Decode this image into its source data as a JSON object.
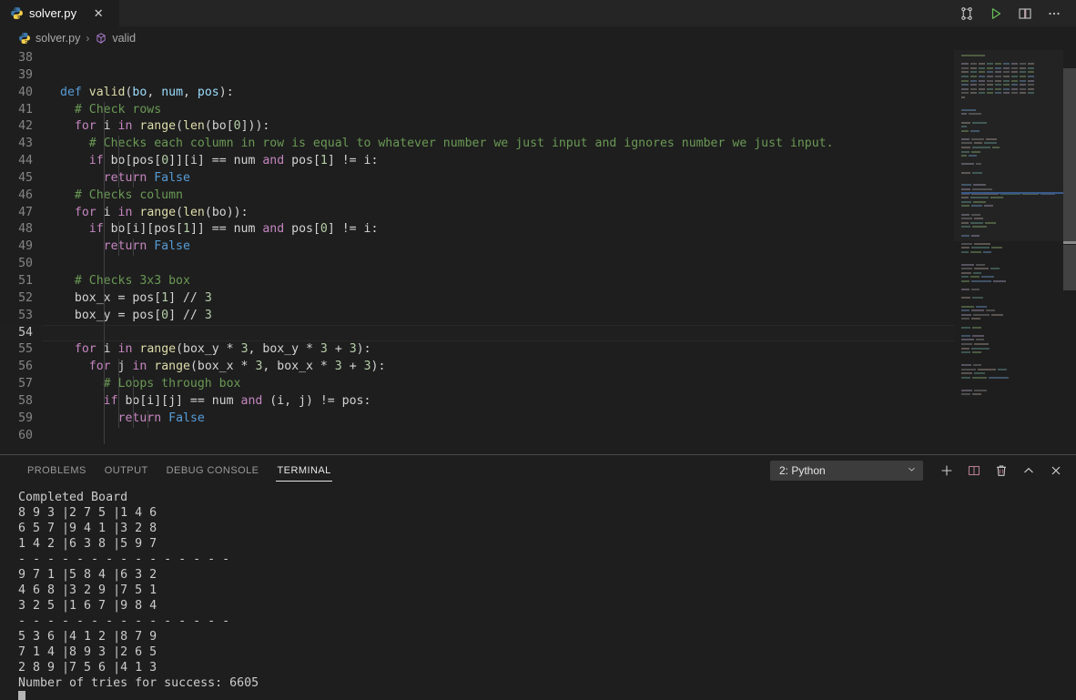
{
  "window": {
    "tab": {
      "filename": "solver.py",
      "icon": "python-icon",
      "close_label": "✕"
    },
    "toolbar": [
      {
        "name": "source-control-icon",
        "title": "Source Control"
      },
      {
        "name": "run-python-file-icon",
        "title": "Run Python File"
      },
      {
        "name": "split-editor-icon",
        "title": "Split Editor Right"
      },
      {
        "name": "more-actions-icon",
        "title": "More Actions..."
      }
    ]
  },
  "breadcrumb": {
    "file_icon": "python-icon",
    "file": "solver.py",
    "separator": "›",
    "symbol_icon": "method-cube-icon",
    "symbol": "valid"
  },
  "editor": {
    "first_line_number": 38,
    "active_line": 54,
    "lines": [
      {
        "n": 38,
        "tokens": []
      },
      {
        "n": 39,
        "tokens": []
      },
      {
        "n": 40,
        "indent": 0,
        "tokens": [
          {
            "t": "def ",
            "c": "kwb"
          },
          {
            "t": "valid",
            "c": "fn"
          },
          {
            "t": "(",
            "c": "op"
          },
          {
            "t": "bo",
            "c": "parm"
          },
          {
            "t": ", ",
            "c": "op"
          },
          {
            "t": "num",
            "c": "parm"
          },
          {
            "t": ", ",
            "c": "op"
          },
          {
            "t": "pos",
            "c": "parm"
          },
          {
            "t": "):",
            "c": "op"
          }
        ]
      },
      {
        "n": 41,
        "indent": 1,
        "tokens": [
          {
            "t": "  # Check rows",
            "c": "cmt"
          }
        ]
      },
      {
        "n": 42,
        "indent": 1,
        "tokens": [
          {
            "t": "  ",
            "c": "pl"
          },
          {
            "t": "for",
            "c": "kw"
          },
          {
            "t": " i ",
            "c": "pl"
          },
          {
            "t": "in",
            "c": "kw"
          },
          {
            "t": " ",
            "c": "pl"
          },
          {
            "t": "range",
            "c": "fn"
          },
          {
            "t": "(",
            "c": "op"
          },
          {
            "t": "len",
            "c": "fn"
          },
          {
            "t": "(bo[",
            "c": "op"
          },
          {
            "t": "0",
            "c": "num"
          },
          {
            "t": "])):",
            "c": "op"
          }
        ]
      },
      {
        "n": 43,
        "indent": 2,
        "tokens": [
          {
            "t": "    # Checks each column in row is equal to whatever number we just input and ignores number we just input.",
            "c": "cmt"
          }
        ]
      },
      {
        "n": 44,
        "indent": 2,
        "tokens": [
          {
            "t": "    ",
            "c": "pl"
          },
          {
            "t": "if",
            "c": "kw"
          },
          {
            "t": " bo[pos[",
            "c": "pl"
          },
          {
            "t": "0",
            "c": "num"
          },
          {
            "t": "]][i] == num ",
            "c": "pl"
          },
          {
            "t": "and",
            "c": "kw"
          },
          {
            "t": " pos[",
            "c": "pl"
          },
          {
            "t": "1",
            "c": "num"
          },
          {
            "t": "] != i:",
            "c": "pl"
          }
        ]
      },
      {
        "n": 45,
        "indent": 3,
        "tokens": [
          {
            "t": "      ",
            "c": "pl"
          },
          {
            "t": "return",
            "c": "kw"
          },
          {
            "t": " ",
            "c": "pl"
          },
          {
            "t": "False",
            "c": "kwb"
          }
        ]
      },
      {
        "n": 46,
        "indent": 1,
        "tokens": [
          {
            "t": "  # Checks column",
            "c": "cmt"
          }
        ]
      },
      {
        "n": 47,
        "indent": 1,
        "tokens": [
          {
            "t": "  ",
            "c": "pl"
          },
          {
            "t": "for",
            "c": "kw"
          },
          {
            "t": " i ",
            "c": "pl"
          },
          {
            "t": "in",
            "c": "kw"
          },
          {
            "t": " ",
            "c": "pl"
          },
          {
            "t": "range",
            "c": "fn"
          },
          {
            "t": "(",
            "c": "op"
          },
          {
            "t": "len",
            "c": "fn"
          },
          {
            "t": "(bo)):",
            "c": "op"
          }
        ]
      },
      {
        "n": 48,
        "indent": 2,
        "tokens": [
          {
            "t": "    ",
            "c": "pl"
          },
          {
            "t": "if",
            "c": "kw"
          },
          {
            "t": " bo[i][pos[",
            "c": "pl"
          },
          {
            "t": "1",
            "c": "num"
          },
          {
            "t": "]] == num ",
            "c": "pl"
          },
          {
            "t": "and",
            "c": "kw"
          },
          {
            "t": " pos[",
            "c": "pl"
          },
          {
            "t": "0",
            "c": "num"
          },
          {
            "t": "] != i:",
            "c": "pl"
          }
        ]
      },
      {
        "n": 49,
        "indent": 3,
        "tokens": [
          {
            "t": "      ",
            "c": "pl"
          },
          {
            "t": "return",
            "c": "kw"
          },
          {
            "t": " ",
            "c": "pl"
          },
          {
            "t": "False",
            "c": "kwb"
          }
        ]
      },
      {
        "n": 50,
        "indent": 1,
        "tokens": []
      },
      {
        "n": 51,
        "indent": 1,
        "tokens": [
          {
            "t": "  # Checks 3x3 box",
            "c": "cmt"
          }
        ]
      },
      {
        "n": 52,
        "indent": 1,
        "tokens": [
          {
            "t": "  box_x = pos[",
            "c": "pl"
          },
          {
            "t": "1",
            "c": "num"
          },
          {
            "t": "] // ",
            "c": "pl"
          },
          {
            "t": "3",
            "c": "num"
          }
        ]
      },
      {
        "n": 53,
        "indent": 1,
        "tokens": [
          {
            "t": "  box_y = pos[",
            "c": "pl"
          },
          {
            "t": "0",
            "c": "num"
          },
          {
            "t": "] // ",
            "c": "pl"
          },
          {
            "t": "3",
            "c": "num"
          }
        ]
      },
      {
        "n": 54,
        "indent": 1,
        "tokens": []
      },
      {
        "n": 55,
        "indent": 1,
        "tokens": [
          {
            "t": "  ",
            "c": "pl"
          },
          {
            "t": "for",
            "c": "kw"
          },
          {
            "t": " i ",
            "c": "pl"
          },
          {
            "t": "in",
            "c": "kw"
          },
          {
            "t": " ",
            "c": "pl"
          },
          {
            "t": "range",
            "c": "fn"
          },
          {
            "t": "(box_y * ",
            "c": "pl"
          },
          {
            "t": "3",
            "c": "num"
          },
          {
            "t": ", box_y * ",
            "c": "pl"
          },
          {
            "t": "3",
            "c": "num"
          },
          {
            "t": " + ",
            "c": "pl"
          },
          {
            "t": "3",
            "c": "num"
          },
          {
            "t": "):",
            "c": "pl"
          }
        ]
      },
      {
        "n": 56,
        "indent": 2,
        "tokens": [
          {
            "t": "    ",
            "c": "pl"
          },
          {
            "t": "for",
            "c": "kw"
          },
          {
            "t": " j ",
            "c": "pl"
          },
          {
            "t": "in",
            "c": "kw"
          },
          {
            "t": " ",
            "c": "pl"
          },
          {
            "t": "range",
            "c": "fn"
          },
          {
            "t": "(box_x * ",
            "c": "pl"
          },
          {
            "t": "3",
            "c": "num"
          },
          {
            "t": ", box_x * ",
            "c": "pl"
          },
          {
            "t": "3",
            "c": "num"
          },
          {
            "t": " + ",
            "c": "pl"
          },
          {
            "t": "3",
            "c": "num"
          },
          {
            "t": "):",
            "c": "pl"
          }
        ]
      },
      {
        "n": 57,
        "indent": 3,
        "tokens": [
          {
            "t": "      # Loops through box",
            "c": "cmt"
          }
        ]
      },
      {
        "n": 58,
        "indent": 3,
        "tokens": [
          {
            "t": "      ",
            "c": "pl"
          },
          {
            "t": "if",
            "c": "kw"
          },
          {
            "t": " bo[i][j] == num ",
            "c": "pl"
          },
          {
            "t": "and",
            "c": "kw"
          },
          {
            "t": " (i, j) != pos:",
            "c": "pl"
          }
        ]
      },
      {
        "n": 59,
        "indent": 4,
        "tokens": [
          {
            "t": "        ",
            "c": "pl"
          },
          {
            "t": "return",
            "c": "kw"
          },
          {
            "t": " ",
            "c": "pl"
          },
          {
            "t": "False",
            "c": "kwb"
          }
        ]
      },
      {
        "n": 60,
        "indent": 1,
        "tokens": []
      }
    ]
  },
  "panel": {
    "tabs": [
      {
        "label": "PROBLEMS",
        "active": false
      },
      {
        "label": "OUTPUT",
        "active": false
      },
      {
        "label": "DEBUG CONSOLE",
        "active": false
      },
      {
        "label": "TERMINAL",
        "active": true
      }
    ],
    "terminal_selector": {
      "value": "2: Python",
      "chevron": "chevron-down-icon"
    },
    "actions": [
      {
        "name": "new-terminal-icon",
        "title": "New Terminal"
      },
      {
        "name": "split-terminal-icon",
        "title": "Split Terminal"
      },
      {
        "name": "kill-terminal-icon",
        "title": "Kill Terminal"
      },
      {
        "name": "maximize-panel-icon",
        "title": "Maximize Panel Size"
      },
      {
        "name": "close-panel-icon",
        "title": "Close Panel"
      }
    ]
  },
  "terminal_output": {
    "heading": "Completed Board",
    "rows": [
      "8 9 3 |2 7 5 |1 4 6",
      "6 5 7 |9 4 1 |3 2 8",
      "1 4 2 |6 3 8 |5 9 7",
      "- - - - - - - - - - - - - - -",
      "9 7 1 |5 8 4 |6 3 2",
      "4 6 8 |3 2 9 |7 5 1",
      "3 2 5 |1 6 7 |9 8 4",
      "- - - - - - - - - - - - - - -",
      "5 3 6 |4 1 2 |8 7 9",
      "7 1 4 |8 9 3 |2 6 5",
      "2 8 9 |7 5 6 |4 1 3"
    ],
    "tries_line": "Number of tries for success: 6605",
    "prompt_partial": ""
  },
  "colors": {
    "editor_bg": "#1e1e1e",
    "tabbar_bg": "#252526",
    "accent_green": "#6ac259",
    "keyword_purple": "#c586c0",
    "keyword_blue": "#569cd6",
    "function_yellow": "#dcdcaa",
    "comment_green": "#6a9955",
    "number_green": "#b5cea8",
    "variable_blue": "#9cdcfe",
    "terminal_fg": "#cccccc"
  }
}
